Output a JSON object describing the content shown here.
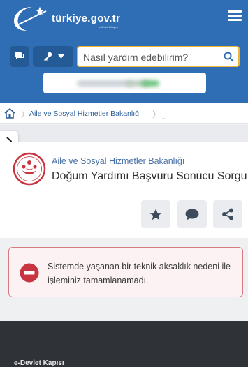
{
  "header": {
    "logo_text": "türkiye.gov.tr",
    "logo_tagline": "e-Devlet Kapısı",
    "search": {
      "placeholder": "Nasıl yardım edebilirim?"
    }
  },
  "breadcrumb": {
    "item": "Aile ve Sosyal Hizmetler Bakanlığı",
    "more": "..."
  },
  "service": {
    "agency": "Aile ve Sosyal Hizmetler Bakanlığı",
    "title": "Doğum Yardımı Başvuru Sonucu Sorgu..."
  },
  "alert": {
    "message": "Sistemde yaşanan bir teknik aksaklık nedeni ile işleminiz tamamlanamadı."
  },
  "footer": {
    "title": "e-Devlet Kapısı"
  },
  "colors": {
    "header_bg": "#2f6eb4",
    "search_border": "#f0b433",
    "alert_border": "#d87a80",
    "alert_icon": "#c8343f",
    "footer_bg": "#2f3338"
  },
  "icons": [
    "logo-crescent-icon",
    "menu-icon",
    "chat-icon",
    "key-icon",
    "chevron-down-icon",
    "search-icon",
    "home-icon",
    "chevron-right-icon",
    "agency-emblem-icon",
    "star-icon",
    "comment-icon",
    "share-icon",
    "error-icon"
  ]
}
